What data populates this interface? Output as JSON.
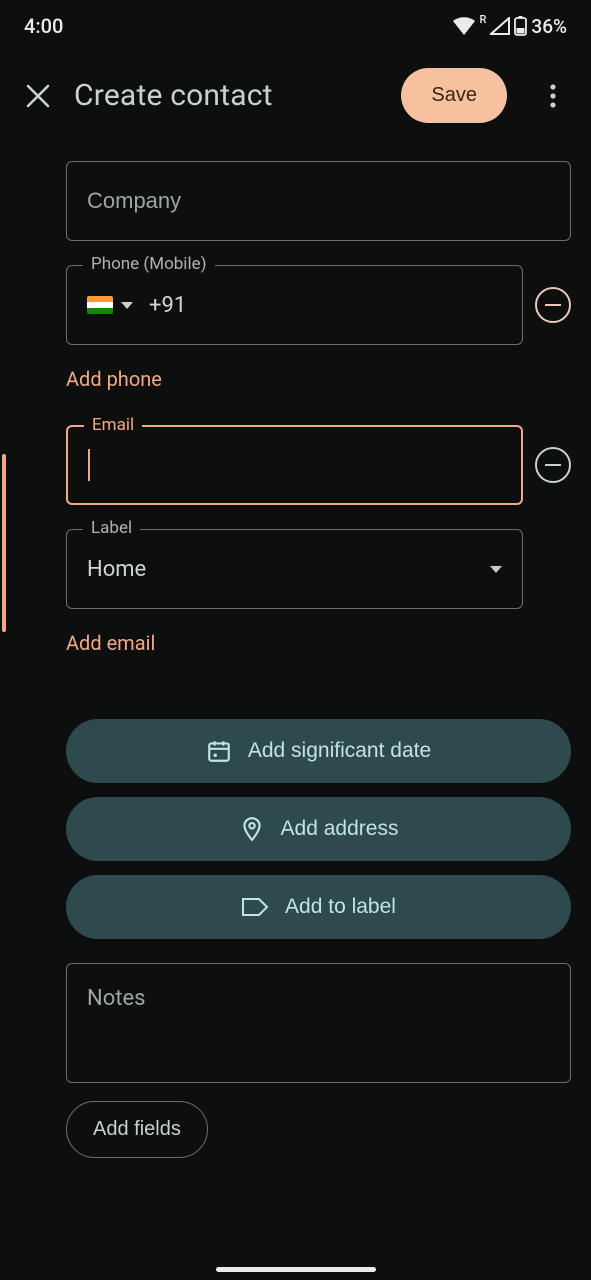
{
  "status": {
    "time": "4:00",
    "battery": "36%",
    "roaming": "R"
  },
  "header": {
    "title": "Create contact",
    "save": "Save"
  },
  "fields": {
    "company_placeholder": "Company",
    "phone": {
      "label": "Phone (Mobile)",
      "value": "+91"
    },
    "add_phone": "Add phone",
    "email": {
      "label": "Email",
      "value": ""
    },
    "label_select": {
      "label": "Label",
      "value": "Home"
    },
    "add_email": "Add email",
    "notes_placeholder": "Notes"
  },
  "chips": {
    "date": "Add significant date",
    "address": "Add address",
    "label": "Add to label"
  },
  "add_fields": "Add fields"
}
